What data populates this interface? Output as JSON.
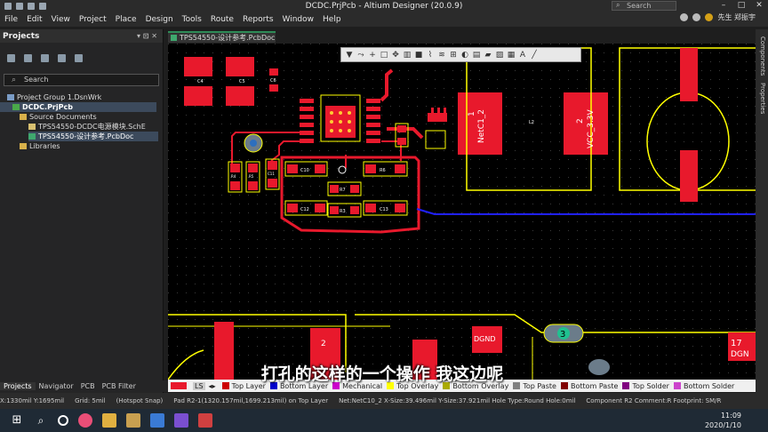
{
  "window": {
    "title": "DCDC.PrjPcb - Altium Designer (20.0.9)",
    "search_placeholder": "Search"
  },
  "menu": [
    "File",
    "Edit",
    "View",
    "Project",
    "Place",
    "Design",
    "Tools",
    "Route",
    "Reports",
    "Window",
    "Help"
  ],
  "user": {
    "label": "先生 郑振宇"
  },
  "projects_panel": {
    "title": "Projects",
    "search_placeholder": "Search",
    "tree": [
      {
        "label": "Project Group 1.DsnWrk",
        "level": 0
      },
      {
        "label": "DCDC.PrjPcb",
        "level": 1
      },
      {
        "label": "Source Documents",
        "level": 2
      },
      {
        "label": "TPS54550-DCDC电源模块.SchE",
        "level": 3
      },
      {
        "label": "TPS54550-设计参考.PcbDoc",
        "level": 3
      },
      {
        "label": "Libraries",
        "level": 2
      }
    ],
    "bottom_tabs": [
      "Projects",
      "Navigator",
      "PCB",
      "PCB Filter"
    ]
  },
  "doc_tab": {
    "label": "TPS54550-设计参考.PcbDoc"
  },
  "right_rail": [
    "Components",
    "Properties"
  ],
  "pcb_labels": {
    "netc1": "NetC1_2",
    "one_a": "1",
    "vcc": "VCC_3.3V",
    "two_a": "2",
    "l2": "L2",
    "dgnd": "DGND",
    "two_b": "2",
    "three": "3",
    "seventeen": "17",
    "dgn": "DGN",
    "c4": "C4",
    "c5": "C5",
    "c6": "C6",
    "r4": "R4",
    "r5": "R5",
    "c11": "C11",
    "c10": "C10",
    "r6": "R6",
    "r7": "R7",
    "c12": "C12",
    "r3": "R3",
    "c13": "C13"
  },
  "layerbar": {
    "ls": "LS",
    "layers": [
      {
        "name": "Top Layer",
        "color": "#cc0000"
      },
      {
        "name": "Bottom Layer",
        "color": "#0000cc"
      },
      {
        "name": "Mechanical",
        "color": "#cc00cc"
      },
      {
        "name": "Top Overlay",
        "color": "#ffff00"
      },
      {
        "name": "Bottom Overlay",
        "color": "#aaaa00"
      },
      {
        "name": "Top Paste",
        "color": "#808080"
      },
      {
        "name": "Bottom Paste",
        "color": "#800000"
      },
      {
        "name": "Top Solder",
        "color": "#800080"
      },
      {
        "name": "Bottom Solder",
        "color": "#cc44cc"
      }
    ]
  },
  "status": {
    "coords": "X:1330mil Y:1695mil",
    "grid": "Grid: 5mil",
    "snap": "(Hotspot Snap)",
    "pad": "Pad R2-1(1320.157mil,1699.213mil) on Top Layer",
    "net": "Net:NetC10_2 X-Size:39.496mil Y-Size:37.921mil Hole Type:Round Hole:0mil",
    "component": "Component R2 Comment:R Footprint: SM/R"
  },
  "clock": {
    "time": "11:09",
    "date": "2020/1/10"
  },
  "subtitle": "打孔的这样的一个操作 我这边呢",
  "colors": {
    "copper": "#e8192c",
    "overlay": "#ffff00",
    "bottom": "#2020ff"
  }
}
